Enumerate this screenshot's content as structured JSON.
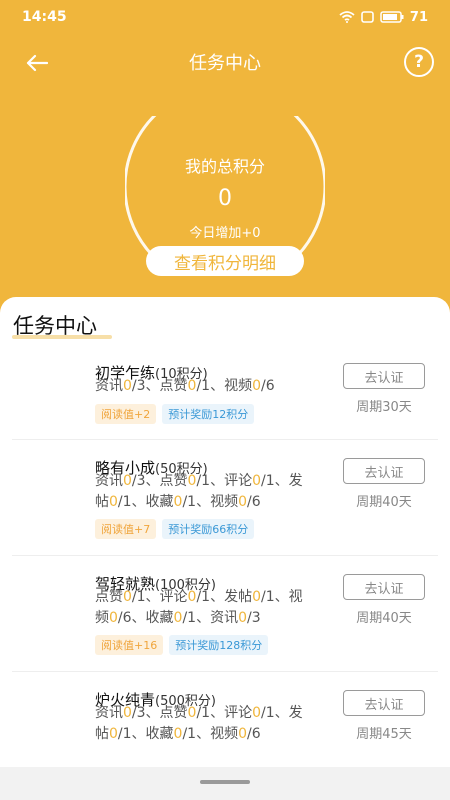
{
  "status_bar": {
    "time": "14:45",
    "battery": "71"
  },
  "header": {
    "title": "任务中心"
  },
  "points": {
    "label": "我的总积分",
    "value": "0",
    "today": "今日增加+0",
    "detail_button": "查看积分明细"
  },
  "section": {
    "title": "任务中心"
  },
  "tasks": [
    {
      "name": "初学乍练",
      "points": "(10积分)",
      "line1": [
        [
          "资讯",
          false
        ],
        [
          "0",
          true
        ],
        [
          "/3、点赞",
          false
        ],
        [
          "0",
          true
        ],
        [
          "/1、视频",
          false
        ],
        [
          "0",
          true
        ],
        [
          "/6",
          false
        ]
      ],
      "line2": [],
      "tag_read": "阅读值+2",
      "tag_reward": "预计奖励12积分",
      "button": "去认证",
      "period": "周期30天"
    },
    {
      "name": "略有小成",
      "points": "(50积分)",
      "line1": [
        [
          "资讯",
          false
        ],
        [
          "0",
          true
        ],
        [
          "/3、点赞",
          false
        ],
        [
          "0",
          true
        ],
        [
          "/1、评论",
          false
        ],
        [
          "0",
          true
        ],
        [
          "/1、发",
          false
        ]
      ],
      "line2": [
        [
          "帖",
          false
        ],
        [
          "0",
          true
        ],
        [
          "/1、收藏",
          false
        ],
        [
          "0",
          true
        ],
        [
          "/1、视频",
          false
        ],
        [
          "0",
          true
        ],
        [
          "/6",
          false
        ]
      ],
      "tag_read": "阅读值+7",
      "tag_reward": "预计奖励66积分",
      "button": "去认证",
      "period": "周期40天"
    },
    {
      "name": "驾轻就熟",
      "points": "(100积分)",
      "line1": [
        [
          "点赞",
          false
        ],
        [
          "0",
          true
        ],
        [
          "/1、评论",
          false
        ],
        [
          "0",
          true
        ],
        [
          "/1、发帖",
          false
        ],
        [
          "0",
          true
        ],
        [
          "/1、视",
          false
        ]
      ],
      "line2": [
        [
          "频",
          false
        ],
        [
          "0",
          true
        ],
        [
          "/6、收藏",
          false
        ],
        [
          "0",
          true
        ],
        [
          "/1、资讯",
          false
        ],
        [
          "0",
          true
        ],
        [
          "/3",
          false
        ]
      ],
      "tag_read": "阅读值+16",
      "tag_reward": "预计奖励128积分",
      "button": "去认证",
      "period": "周期40天"
    },
    {
      "name": "炉火纯青",
      "points": "(500积分)",
      "line1": [
        [
          "资讯",
          false
        ],
        [
          "0",
          true
        ],
        [
          "/3、点赞",
          false
        ],
        [
          "0",
          true
        ],
        [
          "/1、评论",
          false
        ],
        [
          "0",
          true
        ],
        [
          "/1、发",
          false
        ]
      ],
      "line2": [
        [
          "帖",
          false
        ],
        [
          "0",
          true
        ],
        [
          "/1、收藏",
          false
        ],
        [
          "0",
          true
        ],
        [
          "/1、视频",
          false
        ],
        [
          "0",
          true
        ],
        [
          "/6",
          false
        ]
      ],
      "tag_read": "",
      "tag_reward": "",
      "button": "去认证",
      "period": "周期45天"
    }
  ],
  "colors": {
    "primary": "#f0b63c",
    "highlight": "#f0b63c",
    "tag_read_bg": "#fdf0dc",
    "tag_reward_bg": "#eaf4fb"
  }
}
